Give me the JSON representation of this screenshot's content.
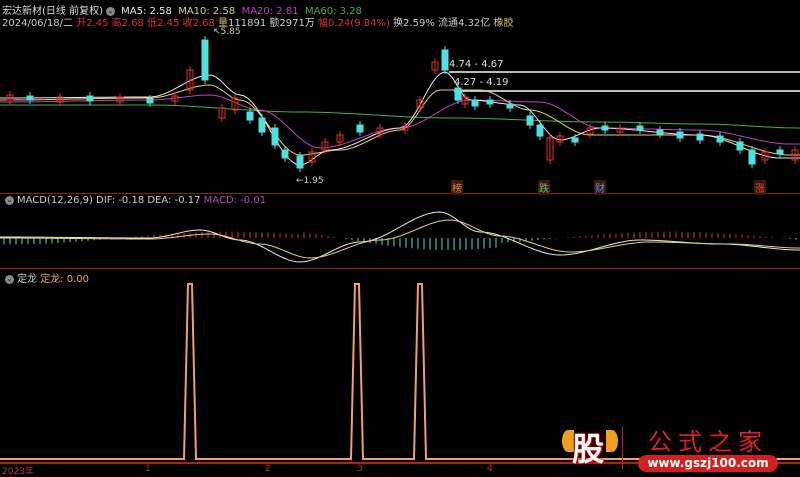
{
  "header": {
    "title": "宏达新材(日线 前复权)",
    "ma5": "MA5: 2.58",
    "ma10": "MA10: 2.58",
    "ma20": "MA20: 2.81",
    "ma60": "MA60: 3.28",
    "date": "2024/06/18/二",
    "open_l": "开",
    "open": "2.45",
    "high_l": "高",
    "high": "2.68",
    "low_l": "低",
    "low": "2.45",
    "close_l": "收",
    "close": "2.68",
    "vol_l": "量",
    "vol": "111891",
    "amt_l": "额",
    "amt": "2971万",
    "chg_l": "幅",
    "chg": "0.24(9.84%)",
    "turn": "换2.59%",
    "float": "流通4.32亿",
    "sector": "橡胶"
  },
  "main": {
    "high_label": "5.85",
    "low_label": "1.95",
    "range1": "4.74 - 4.67",
    "range2": "4.27 - 4.19",
    "tags": [
      {
        "text": "榜",
        "color": "#e08040"
      },
      {
        "text": "跌",
        "color": "#60c060"
      },
      {
        "text": "财",
        "color": "#6090e0"
      },
      {
        "text": "涨",
        "color": "#e04040"
      }
    ]
  },
  "macd": {
    "title": "MACD(12,26,9)",
    "dif": "DIF: -0.18",
    "dea": "DEA: -0.17",
    "macd": "MACD: -0.01"
  },
  "indicator": {
    "name": "定龙",
    "label": "定龙: 0.00"
  },
  "xaxis": [
    "2023年",
    "1",
    "2",
    "3",
    "4"
  ],
  "watermark": {
    "logo": "股",
    "text": "公式之家",
    "url": "www.gszj100.com"
  },
  "colors": {
    "ma5": "#e8e8e8",
    "ma10": "#e8d070",
    "ma20": "#c040c0",
    "ma60": "#40b040",
    "up": "#e03030",
    "down": "#50e0e0",
    "spike": "#f0a070",
    "border": "#8a1a1a"
  }
}
